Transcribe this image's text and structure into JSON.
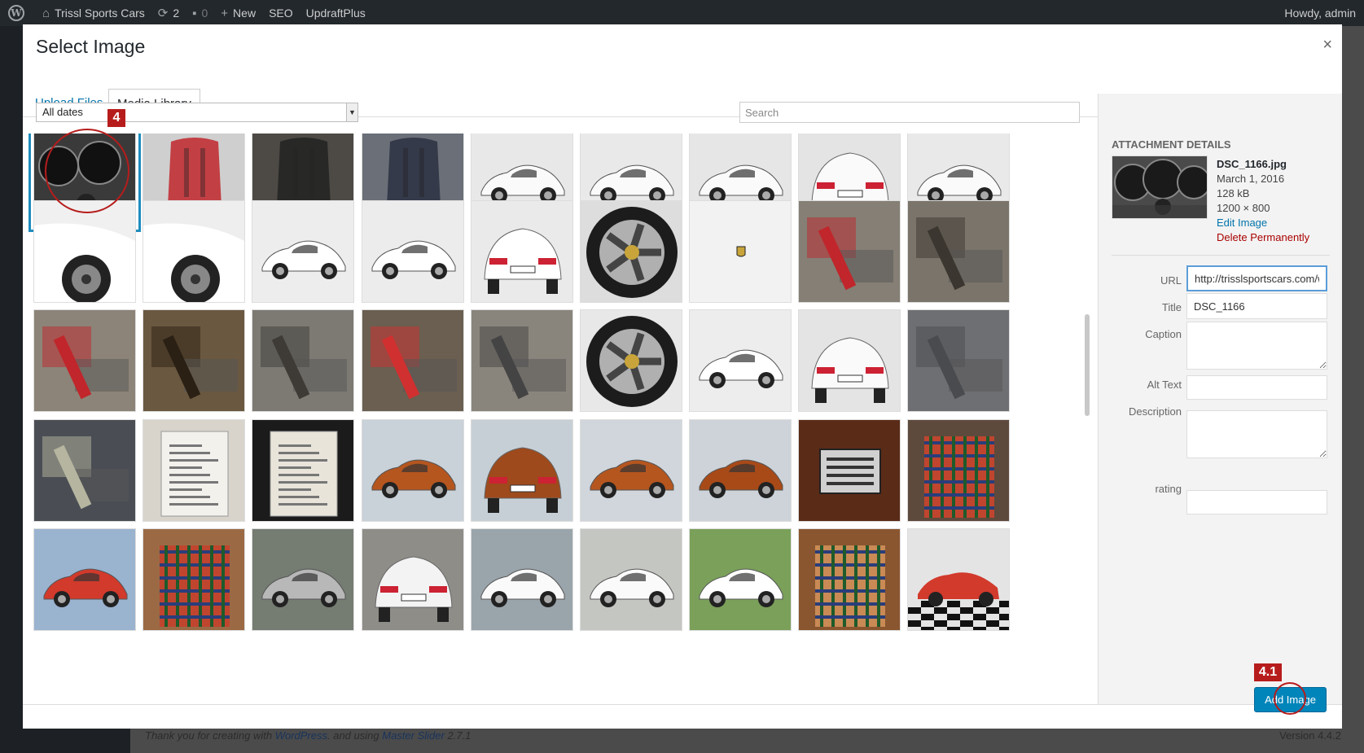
{
  "adminbar": {
    "site_name": "Trissl Sports Cars",
    "updates_count": "2",
    "comments_count": "0",
    "new_label": "New",
    "seo_label": "SEO",
    "updraft_label": "UpdraftPlus",
    "greeting": "Howdy, admin"
  },
  "footer": {
    "thanks_prefix": "Thank you for creating with",
    "wordpress_link": "WordPress",
    "and_using": ". and using",
    "slider_link": "Master Slider",
    "slider_version": "2.7.1",
    "wp_version": "Version 4.4.2"
  },
  "modal": {
    "title": "Select Image",
    "close": "×",
    "tabs": [
      "Upload Files",
      "Media Library"
    ],
    "date_filter": "All dates",
    "search_placeholder": "Search",
    "add_button": "Add Image"
  },
  "details": {
    "heading": "Attachment Details",
    "filename": "DSC_1166.jpg",
    "date": "March 1, 2016",
    "size": "128 kB",
    "dimensions": "1200 × 800",
    "edit_link": "Edit Image",
    "delete_link": "Delete Permanently",
    "fields": {
      "url": {
        "label": "URL",
        "value": "http://trisslsportscars.com/w"
      },
      "title": {
        "label": "Title",
        "value": "DSC_1166"
      },
      "caption": {
        "label": "Caption",
        "value": ""
      },
      "alt": {
        "label": "Alt Text",
        "value": ""
      },
      "description": {
        "label": "Description",
        "value": ""
      },
      "rating": {
        "label": "rating",
        "value": ""
      }
    }
  },
  "annotations": [
    "4",
    "4.1"
  ],
  "grid": {
    "rows": [
      [
        "dashboard-gauges",
        "red-harness-seat",
        "dark-interior",
        "grey-seats",
        "white-911-front",
        "white-911-side",
        "white-911-rear-quarter",
        "white-911-rear",
        "white-911-side"
      ],
      [
        "white-911-fender",
        "white-911-rear-wheel",
        "white-911-profile",
        "white-911-front-quarter",
        "white-911-nose",
        "fuchs-wheel",
        "porsche-crest",
        "red-suspension",
        "engine-underside"
      ],
      [
        "red-shock",
        "rusty-underbody",
        "engine-bay",
        "red-strut",
        "transaxle",
        "fuchs-wheel-closeup",
        "white-911-profile",
        "white-911-rear",
        "floor-pan"
      ],
      [
        "engine-fan",
        "certificate",
        "certificate-dark",
        "orange-911",
        "orange-911-rear",
        "orange-911-front",
        "orange-911-side",
        "vin-plate",
        "tartan-seats"
      ],
      [
        "red-911",
        "tartan-door",
        "silver-cayman",
        "white-911-wet",
        "white-911-lot",
        "white-911-parked",
        "white-cayman-show",
        "tartan-seats-tan",
        "red-911-checkers"
      ]
    ]
  }
}
